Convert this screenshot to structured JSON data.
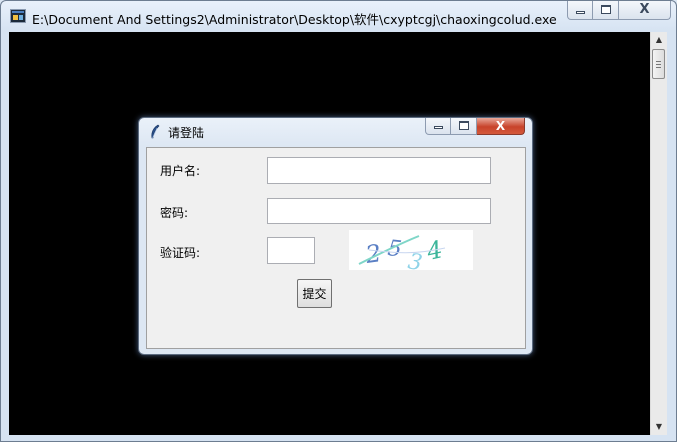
{
  "window": {
    "title": "E:\\Document And Settings2\\Administrator\\Desktop\\软件\\cxyptcgj\\chaoxingcolud.exe",
    "icon": "console-app-icon",
    "close_glyph": "X"
  },
  "dialog": {
    "title": "请登陆",
    "icon": "feather-icon",
    "close_glyph": "X",
    "username_label": "用户名:",
    "password_label": "密码:",
    "captcha_label": "验证码:",
    "username_value": "",
    "password_value": "",
    "captcha_value": "",
    "captcha_text": "2534",
    "submit_label": "提交"
  },
  "colors": {
    "console_background": "#000000",
    "dialog_close_red": "#c8432b",
    "captcha_digit_blue": "#5a7fc4",
    "captcha_digit_teal": "#3bb59a"
  }
}
